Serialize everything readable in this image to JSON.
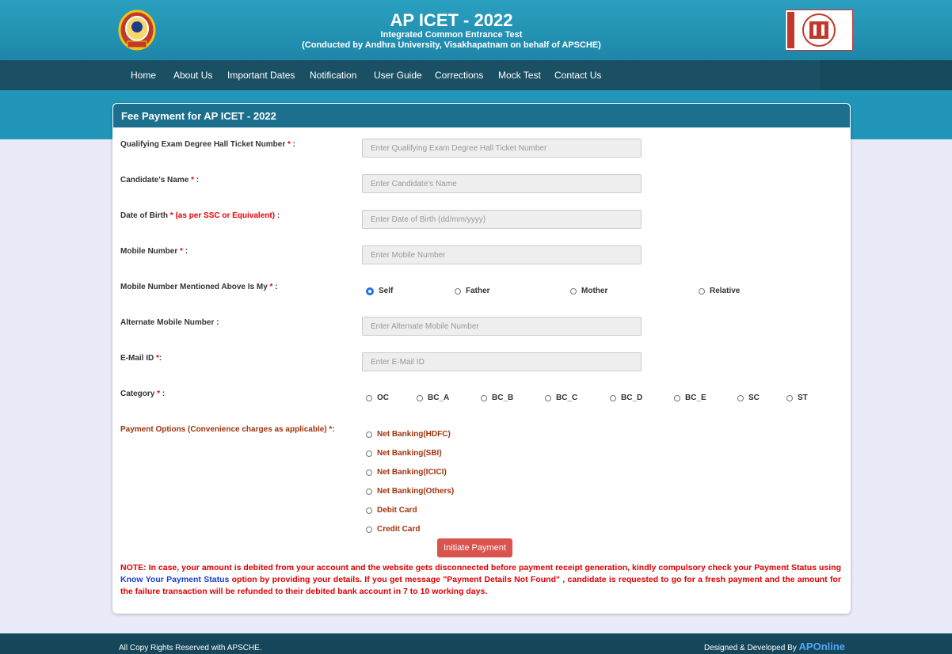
{
  "header": {
    "title": "AP ICET - 2022",
    "subtitle": "Integrated Common Entrance Test",
    "conducted_by": "(Conducted by Andhra University, Visakhapatnam on behalf of APSCHE)"
  },
  "nav": {
    "items": [
      "Home",
      "About Us",
      "Important Dates",
      "Notification",
      "User Guide",
      "Corrections",
      "Mock Test",
      "Contact Us"
    ]
  },
  "form": {
    "heading": "Fee Payment for AP ICET - 2022",
    "hall_ticket": {
      "label": "Qualifying Exam Degree Hall Ticket Number",
      "req": "*",
      "colon": " :",
      "placeholder": "Enter Qualifying Exam Degree Hall Ticket Number",
      "value": ""
    },
    "name": {
      "label": "Candidate's Name",
      "req": "*",
      "colon": " :",
      "placeholder": "Enter Candidate's Name",
      "value": ""
    },
    "dob": {
      "label": "Date of Birth",
      "req": "* (as per SSC or Equivalent)",
      "colon": " :",
      "placeholder": "Enter Date of Birth (dd/mm/yyyy)",
      "value": ""
    },
    "mobile": {
      "label": "Mobile Number",
      "req": "*",
      "colon": " :",
      "placeholder": "Enter Mobile Number",
      "value": ""
    },
    "mobile_owner": {
      "label": "Mobile Number Mentioned Above Is My",
      "req": "*",
      "colon": " :",
      "options": [
        "Self",
        "Father",
        "Mother",
        "Relative"
      ],
      "selected": "Self"
    },
    "alt_mobile": {
      "label": "Alternate Mobile Number :",
      "placeholder": "Enter Alternate Mobile Number",
      "value": ""
    },
    "email": {
      "label": "E-Mail ID",
      "req": "*",
      "colon": ":",
      "placeholder": "Enter E-Mail ID",
      "value": ""
    },
    "category": {
      "label": "Category",
      "req": "*",
      "colon": " :",
      "options": [
        "OC",
        "BC_A",
        "BC_B",
        "BC_C",
        "BC_D",
        "BC_E",
        "SC",
        "ST"
      ]
    },
    "payment": {
      "label": "Payment Options (Convenience charges as applicable) *:",
      "options": [
        "Net Banking(HDFC)",
        "Net Banking(SBI)",
        "Net Banking(ICICI)",
        "Net Banking(Others)",
        "Debit Card",
        "Credit Card"
      ]
    },
    "submit_label": "Initiate Payment",
    "note_pre": "NOTE: In case, your amount is debited from your account and the website gets disconnected before payment receipt generation, kindly compulsory check your Payment Status using ",
    "note_link": "Know Your Payment Status",
    "note_post": " option by providing your details. If you get message \"Payment Details Not Found\" , candidate is requested to go for a fresh payment and the amount for the failure transaction will be refunded to their debited bank account in 7 to 10 working days."
  },
  "footer": {
    "copyright": "All Copy Rights Reserved with APSCHE.",
    "designed_by": "Designed & Developed By ",
    "developer": "APOnline"
  },
  "colors": {
    "header": "#1e86a8",
    "nav": "#1b5064",
    "accent": "#d9534f",
    "required": "#e00000",
    "selected_radio": "#1a73e8"
  },
  "icons": {
    "left_logo": "andhra-university-emblem-icon",
    "right_logo": "apsche-emblem-icon"
  }
}
